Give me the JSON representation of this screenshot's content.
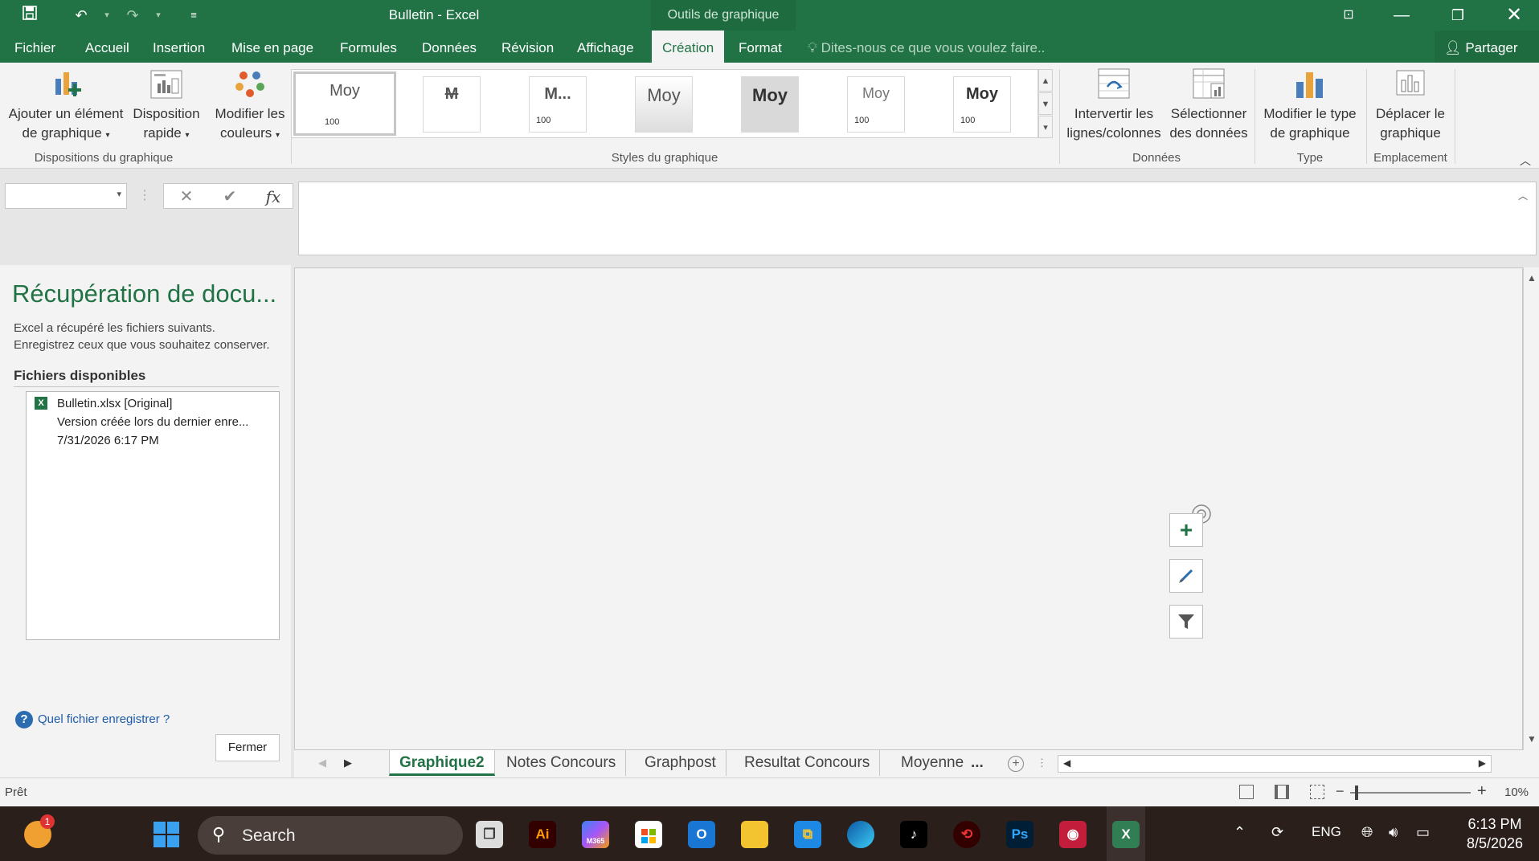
{
  "window": {
    "title": "Bulletin - Excel",
    "context_tab_group": "Outils de graphique"
  },
  "quick_access": {
    "icons": [
      "save-icon",
      "undo-icon",
      "redo-icon",
      "customize-icon"
    ]
  },
  "tabs": [
    {
      "label": "Fichier"
    },
    {
      "label": "Accueil"
    },
    {
      "label": "Insertion"
    },
    {
      "label": "Mise en page"
    },
    {
      "label": "Formules"
    },
    {
      "label": "Données"
    },
    {
      "label": "Révision"
    },
    {
      "label": "Affichage"
    },
    {
      "label": "Création",
      "active": true
    },
    {
      "label": "Format"
    }
  ],
  "tell_me": "Dites-nous ce que vous voulez faire..",
  "share": "Partager",
  "ribbon": {
    "add_element": {
      "line1": "Ajouter un élément",
      "line2": "de graphique"
    },
    "quick_layout": {
      "line1": "Disposition",
      "line2": "rapide"
    },
    "change_colors": {
      "line1": "Modifier les",
      "line2": "couleurs"
    },
    "group_layouts": "Dispositions du graphique",
    "styles": [
      {
        "label": "Moy",
        "num": "100"
      },
      {
        "label": "M",
        "num": ""
      },
      {
        "label": "M...",
        "num": "100"
      },
      {
        "label": "Moy",
        "num": ""
      },
      {
        "label": "Moy",
        "num": ""
      },
      {
        "label": "Moy",
        "num": "100"
      },
      {
        "label": "Moy",
        "num": "100"
      }
    ],
    "group_styles": "Styles du graphique",
    "switch_rowcol": {
      "line1": "Intervertir les",
      "line2": "lignes/colonnes"
    },
    "select_data": {
      "line1": "Sélectionner",
      "line2": "des données"
    },
    "group_data": "Données",
    "change_type": {
      "line1": "Modifier le type",
      "line2": "de graphique"
    },
    "group_type": "Type",
    "move_chart": {
      "line1": "Déplacer le",
      "line2": "graphique"
    },
    "group_location": "Emplacement"
  },
  "formula_bar": {
    "cancel": "✕",
    "enter": "✔",
    "fx": "fx",
    "name_box": "",
    "formula": ""
  },
  "recovery": {
    "title": "Récupération de docu...",
    "desc1": "Excel a récupéré les fichiers suivants.",
    "desc2": "Enregistrez ceux que vous souhaitez conserver.",
    "files_label": "Fichiers disponibles",
    "file": {
      "name": "Bulletin.xlsx  [Original]",
      "desc": "Version créée lors du dernier enre...",
      "date": "7/31/2026 6:17 PM"
    },
    "help_link": "Quel fichier enregistrer ?",
    "close_button": "Fermer"
  },
  "sheets": [
    {
      "label": "Graphique2",
      "active": true
    },
    {
      "label": "Notes Concours"
    },
    {
      "label": "Graphpost"
    },
    {
      "label": "Resultat Concours"
    },
    {
      "label": "Moyenne"
    }
  ],
  "sheet_more": "...",
  "status": {
    "ready": "Prêt",
    "zoom": "10%"
  },
  "taskbar": {
    "search": "Search",
    "lang": "ENG",
    "time": "6:13 PM",
    "date": "8/5/2026",
    "weather_badge": "1",
    "m365_label": "M365"
  },
  "colors": {
    "excel_green": "#217346",
    "ribbon_bg": "#f3f3f3",
    "taskbar_bg": "#2b1f1c"
  }
}
